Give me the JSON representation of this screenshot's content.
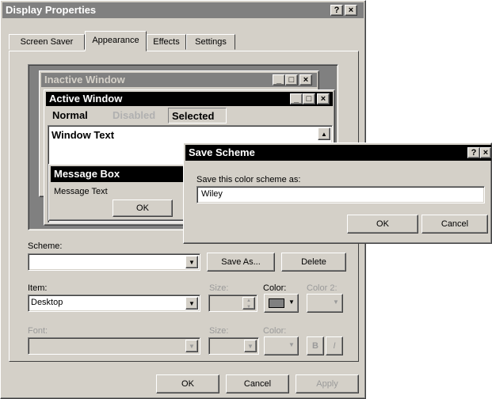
{
  "window": {
    "title": "Display Properties",
    "help": "?",
    "close": "×"
  },
  "tabs": [
    {
      "label": "Screen Saver"
    },
    {
      "label": "Appearance"
    },
    {
      "label": "Effects"
    },
    {
      "label": "Settings"
    }
  ],
  "preview": {
    "inactive_title": "Inactive Window",
    "active_title": "Active Window",
    "menu_normal": "Normal",
    "menu_disabled": "Disabled",
    "menu_selected": "Selected",
    "window_text": "Window Text",
    "msgbox_title": "Message Box",
    "msgbox_text": "Message Text",
    "msgbox_ok": "OK"
  },
  "scheme": {
    "label": "Scheme:",
    "value": "",
    "save_as": "Save As...",
    "delete": "Delete"
  },
  "item": {
    "label": "Item:",
    "value": "Desktop",
    "size_label": "Size:",
    "color_label": "Color:",
    "color2_label": "Color 2:"
  },
  "font": {
    "label": "Font:",
    "size_label": "Size:",
    "color_label": "Color:",
    "bold": "B",
    "italic": "I"
  },
  "footer": {
    "ok": "OK",
    "cancel": "Cancel",
    "apply": "Apply"
  },
  "save_dialog": {
    "title": "Save Scheme",
    "help": "?",
    "close": "×",
    "prompt": "Save this color scheme as:",
    "value": "Wiley",
    "ok": "OK",
    "cancel": "Cancel"
  },
  "colors": {
    "title_active": "#000000",
    "title_inactive": "#808080",
    "face": "#d4d0c8"
  }
}
